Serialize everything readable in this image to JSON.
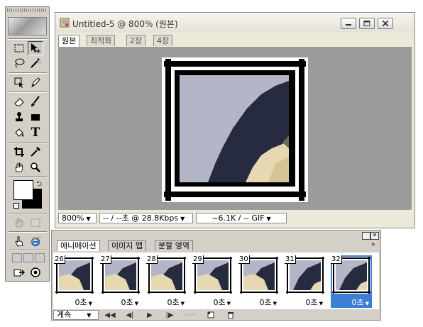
{
  "toolbox": {
    "tools": [
      {
        "name": "marquee-icon"
      },
      {
        "name": "move-icon"
      },
      {
        "name": "lasso-icon"
      },
      {
        "name": "magic-wand-icon"
      },
      {
        "name": "crop-select-icon"
      },
      {
        "name": "pen-icon"
      },
      {
        "name": "eraser-icon"
      },
      {
        "name": "brush-icon"
      },
      {
        "name": "stamp-icon"
      },
      {
        "name": "rectangle-icon"
      },
      {
        "name": "bucket-icon"
      },
      {
        "name": "type-icon"
      },
      {
        "name": "crop-icon"
      },
      {
        "name": "eyedropper-icon"
      },
      {
        "name": "hand-icon"
      },
      {
        "name": "zoom-icon"
      }
    ],
    "type_tool_label": "T",
    "foreground_color": "#ffffff",
    "background_color": "#000000"
  },
  "document": {
    "title": "Untitled-5 @ 800% (원본)",
    "tabs": [
      "원본",
      "최적화",
      "2장",
      "4장"
    ],
    "active_tab": 0,
    "status": {
      "zoom": "800%",
      "download": "-- / --초 @ 28.8Kbps",
      "size_format": "~6.1K / -- GIF"
    }
  },
  "animation_panel": {
    "tabs": [
      "애니메이션",
      "이미지 맵",
      "분할 영역"
    ],
    "active_tab": 0,
    "frames": [
      {
        "number": "26",
        "delay": "0초"
      },
      {
        "number": "27",
        "delay": "0초"
      },
      {
        "number": "28",
        "delay": "0초"
      },
      {
        "number": "29",
        "delay": "0초"
      },
      {
        "number": "30",
        "delay": "0초"
      },
      {
        "number": "31",
        "delay": "0초"
      },
      {
        "number": "32",
        "delay": "0초",
        "selected": true
      }
    ],
    "loop_option": "계속",
    "colors": {
      "selection": "#3d7fd6"
    }
  }
}
